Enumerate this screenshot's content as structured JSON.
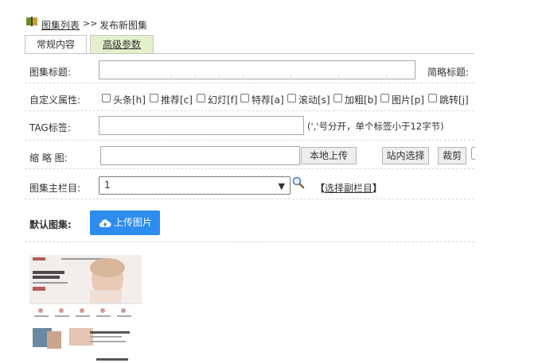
{
  "breadcrumb": {
    "list_link": "图集列表",
    "separator": ">>",
    "current": "发布新图集"
  },
  "tabs": [
    {
      "label": "常规内容"
    },
    {
      "label": "高级参数"
    }
  ],
  "form": {
    "title_label": "图集标题:",
    "short_title_label": "简略标题:",
    "custom_attr_label": "自定义属性:",
    "attributes": [
      "头条[h]",
      "推荐[c]",
      "幻灯[f]",
      "特荐[a]",
      "滚动[s]",
      "加粗[b]",
      "图片[p]",
      "跳转[j]"
    ],
    "tag_label": "TAG标签:",
    "tag_hint": "(','号分开，单个标签小于12字节)",
    "thumb_label": "缩 略 图:",
    "local_upload": "本地上传",
    "site_select": "站内选择",
    "crop": "裁剪",
    "main_column_label": "图集主栏目:",
    "main_column_value": "1",
    "select_sub_column": "【选择副栏目】",
    "default_gallery_label": "默认图集:",
    "upload_images": "上传图片"
  },
  "thumbnail": {
    "headline": "Perfect Face Surgery For Everyone.",
    "section_title": "We are the top-notch plastic surgery center",
    "footer_title": "Recent Cases and Tutorials"
  }
}
